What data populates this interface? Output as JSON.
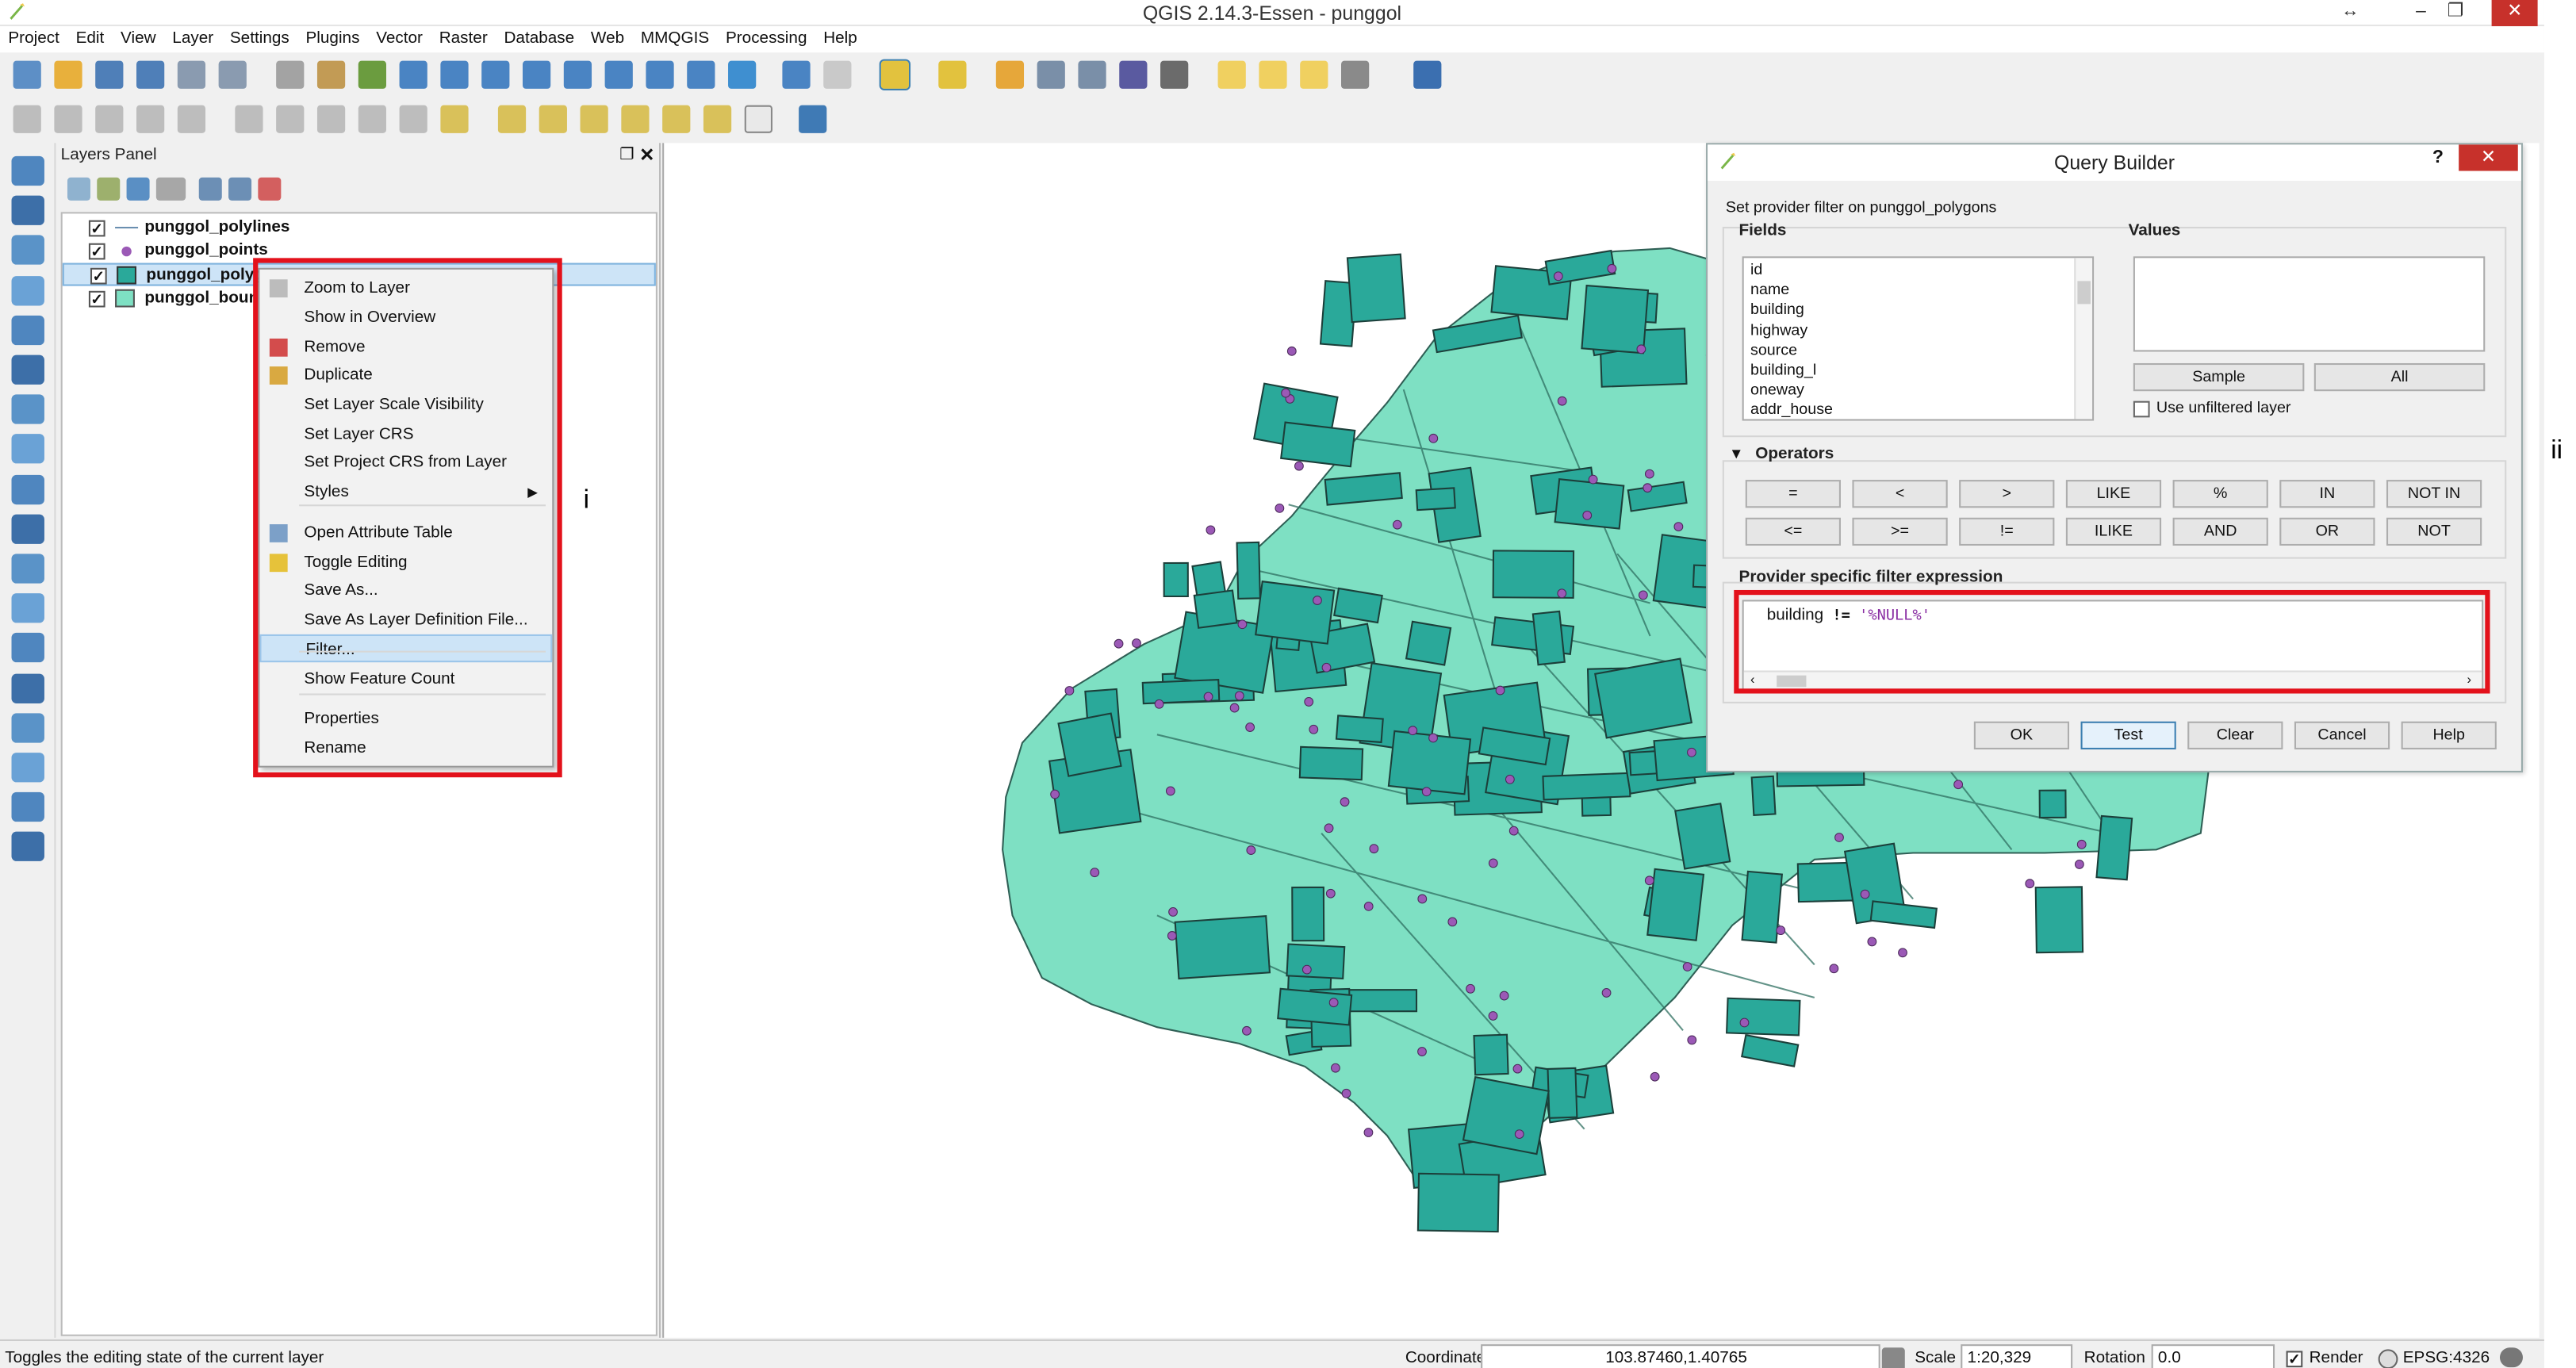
{
  "window": {
    "title": "QGIS 2.14.3-Essen - punggol",
    "minimize": "–",
    "restore": "❐",
    "close": "✕",
    "resize_glyph": "↔"
  },
  "menubar": [
    "Project",
    "Edit",
    "View",
    "Layer",
    "Settings",
    "Plugins",
    "Vector",
    "Raster",
    "Database",
    "Web",
    "MMQGIS",
    "Processing",
    "Help"
  ],
  "toolbar1_icons": [
    "new-project",
    "open-project",
    "save-project",
    "save-as",
    "new-print-composer",
    "composer-manager",
    "touch-zoom",
    "pan-map",
    "pan-to-selection",
    "zoom-in",
    "zoom-out",
    "zoom-full",
    "zoom-selection",
    "zoom-layer",
    "zoom-native",
    "zoom-last",
    "zoom-next",
    "refresh",
    "identify",
    "map-tips",
    "select-features",
    "deselect",
    "select-by-expression",
    "open-attribute-table",
    "field-calculator",
    "statistics",
    "measure",
    "annotation-text",
    "annotation-form",
    "annotation-svg",
    "text-annotation",
    "help"
  ],
  "toolbar2_icons": [
    "current-edits",
    "toggle-editing",
    "save-edits",
    "add-feature",
    "move-feature",
    "node-tool",
    "delete-selected",
    "cut-features",
    "copy-features",
    "paste-features",
    "label-tool",
    "label-highlight",
    "pin-labels",
    "show-hide-labels",
    "move-label",
    "rotate-label",
    "change-label",
    "csw",
    "python-console"
  ],
  "left_strip_icons": [
    "add-vector-layer",
    "add-raster-layer",
    "add-postgis-layer",
    "add-spatialite-layer",
    "add-mssql-layer",
    "add-oracle-layer",
    "add-wms-layer",
    "add-wcs-layer",
    "add-wfs-layer",
    "add-virtual-layer",
    "add-delimited-text-layer",
    "new-shapefile-layer",
    "new-spatialite-layer",
    "new-gps-layer",
    "add-gpx",
    "georeferencer",
    "digitize-tool",
    "geometry-checker"
  ],
  "layers_panel": {
    "title": "Layers Panel",
    "layers": [
      {
        "name": "punggol_polylines",
        "checked": true,
        "symbol": "line"
      },
      {
        "name": "punggol_points",
        "checked": true,
        "symbol": "point"
      },
      {
        "name": "punggol_polygons",
        "checked": true,
        "symbol": "polygon-dark",
        "selected": true
      },
      {
        "name": "punggol_boundary",
        "checked": true,
        "symbol": "polygon-light"
      }
    ]
  },
  "context_menu": {
    "items": [
      {
        "label": "Zoom to Layer",
        "icon": "zoom-layer-icon"
      },
      {
        "label": "Show in Overview",
        "icon": ""
      },
      {
        "label": "Remove",
        "icon": "remove-layer-icon"
      },
      {
        "label": "Duplicate",
        "icon": "duplicate-icon"
      },
      {
        "label": "Set Layer Scale Visibility",
        "icon": ""
      },
      {
        "label": "Set Layer CRS",
        "icon": ""
      },
      {
        "label": "Set Project CRS from Layer",
        "icon": ""
      },
      {
        "label": "Styles",
        "icon": "",
        "submenu": true
      },
      {
        "label": "Open Attribute Table",
        "icon": "attribute-table-icon"
      },
      {
        "label": "Toggle Editing",
        "icon": "pencil-icon"
      },
      {
        "label": "Save As...",
        "icon": ""
      },
      {
        "label": "Save As Layer Definition File...",
        "icon": ""
      },
      {
        "label": "Filter...",
        "icon": "",
        "highlighted": true
      },
      {
        "label": "Show Feature Count",
        "icon": ""
      },
      {
        "label": "Properties",
        "icon": ""
      },
      {
        "label": "Rename",
        "icon": ""
      }
    ],
    "annotation": "i"
  },
  "query_builder": {
    "title": "Query Builder",
    "help_glyph": "?",
    "close_glyph": "✕",
    "subtitle": "Set provider filter on punggol_polygons",
    "fields_label": "Fields",
    "fields": [
      "id",
      "name",
      "building",
      "highway",
      "source",
      "building_l",
      "oneway",
      "addr_house"
    ],
    "values_label": "Values",
    "sample_button": "Sample",
    "all_button": "All",
    "use_unfiltered": "Use unfiltered layer",
    "operators_label": "Operators",
    "operators_row1": [
      "=",
      "<",
      ">",
      "LIKE",
      "%",
      "IN",
      "NOT IN"
    ],
    "operators_row2": [
      "<=",
      ">=",
      "!=",
      "ILIKE",
      "AND",
      "OR",
      "NOT"
    ],
    "expression_label": "Provider specific filter expression",
    "expression": {
      "field": "building",
      "op": "!=",
      "value": "'%NULL%'"
    },
    "buttons": {
      "ok": "OK",
      "test": "Test",
      "clear": "Clear",
      "cancel": "Cancel",
      "help": "Help"
    },
    "annotation": "ii"
  },
  "statusbar": {
    "message": "Toggles the editing state of the current layer",
    "coordinate_label": "Coordinate",
    "coordinate_value": "103.87460,1.40765",
    "scale_label": "Scale",
    "scale_value": "1:20,329",
    "rotation_label": "Rotation",
    "rotation_value": "0.0",
    "render_label": "Render",
    "crs": "EPSG:4326"
  },
  "colors": {
    "highlight_red": "#e3111b",
    "polygon_dark": "#2aa99a",
    "polygon_light": "#7ee0c3",
    "point": "#9b59b6",
    "selection_blue": "#cde4f7"
  }
}
